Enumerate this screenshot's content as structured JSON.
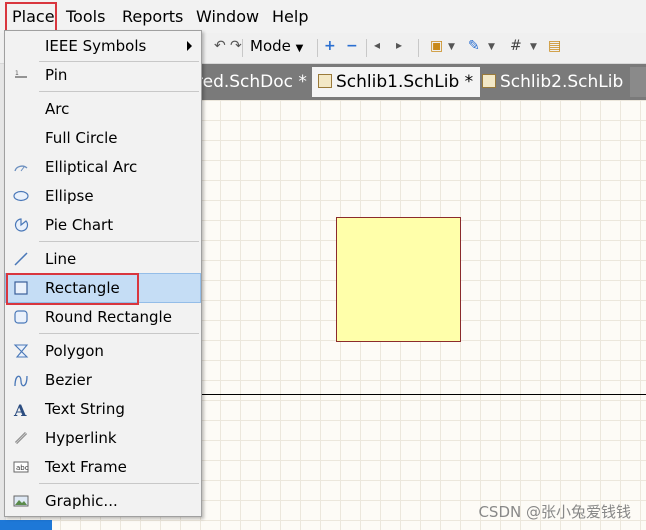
{
  "menubar": {
    "place": "Place",
    "tools": "Tools",
    "reports": "Reports",
    "window": "Window",
    "help": "Help"
  },
  "toolbar": {
    "mode_label": "Mode"
  },
  "tabs": [
    {
      "label": "red.SchDoc *"
    },
    {
      "label": "Schlib1.SchLib *"
    },
    {
      "label": "Schlib2.SchLib"
    }
  ],
  "place_menu": {
    "items": [
      {
        "label": "IEEE Symbols",
        "icon": "none",
        "submenu": true
      },
      {
        "label": "Pin",
        "icon": "pin-icon"
      },
      {
        "label": "Arc",
        "icon": "none"
      },
      {
        "label": "Full Circle",
        "icon": "none"
      },
      {
        "label": "Elliptical Arc",
        "icon": "elliptical-arc-icon"
      },
      {
        "label": "Ellipse",
        "icon": "ellipse-icon"
      },
      {
        "label": "Pie Chart",
        "icon": "pie-chart-icon"
      },
      {
        "label": "Line",
        "icon": "line-icon"
      },
      {
        "label": "Rectangle",
        "icon": "rectangle-icon",
        "highlighted": true
      },
      {
        "label": "Round Rectangle",
        "icon": "round-rectangle-icon"
      },
      {
        "label": "Polygon",
        "icon": "polygon-icon"
      },
      {
        "label": "Bezier",
        "icon": "bezier-icon"
      },
      {
        "label": "Text String",
        "icon": "text-string-icon"
      },
      {
        "label": "Hyperlink",
        "icon": "hyperlink-icon"
      },
      {
        "label": "Text Frame",
        "icon": "text-frame-icon"
      },
      {
        "label": "Graphic...",
        "icon": "graphic-icon"
      }
    ]
  },
  "watermark": "CSDN @张小兔爱钱钱",
  "colors": {
    "highlight": "#c5ddf5",
    "selection_border": "#d9363e",
    "rectangle_fill": "#ffffaa",
    "rectangle_border": "#8b2b2b"
  }
}
